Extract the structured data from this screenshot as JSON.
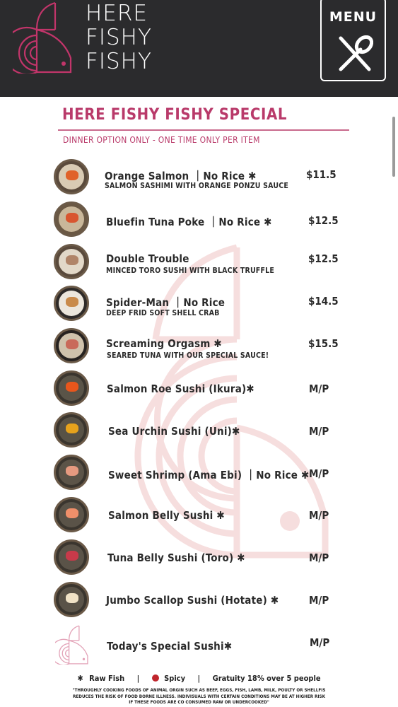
{
  "brand": {
    "line1": "HERE",
    "line2": "FISHY",
    "line3": "FISHY",
    "accent_color": "#c2356a",
    "header_bg": "#2b2b2d"
  },
  "menu_button": {
    "label": "MENU",
    "icon": "fork-spoon-icon"
  },
  "section": {
    "title": "HERE FISHY FISHY SPECIAL",
    "subtitle": "DINNER OPTION ONLY - ONE TIME ONLY PER ITEM"
  },
  "items": [
    {
      "name": "Orange Salmon ｜No Rice ✱",
      "desc": "SALMON SASHIMI WITH ORANGE PONZU SAUCE",
      "price": "$11.5"
    },
    {
      "name": "Bluefin Tuna Poke ｜No Rice ✱",
      "desc": "",
      "price": "$12.5"
    },
    {
      "name": "Double Trouble",
      "desc": "MINCED TORO SUSHI WITH BLACK TRUFFLE",
      "price": "$12.5"
    },
    {
      "name": "Spider-Man ｜No Rice",
      "desc": "DEEP FRID SOFT SHELL CRAB",
      "price": "$14.5"
    },
    {
      "name": "Screaming Orgasm ✱",
      "desc": "SEARED TUNA WITH OUR SPECIAL SAUCE!",
      "price": "$15.5"
    },
    {
      "name": "Salmon Roe Sushi (Ikura)✱",
      "desc": "",
      "price": "M/P"
    },
    {
      "name": "Sea Urchin Sushi (Uni)✱",
      "desc": "",
      "price": "M/P"
    },
    {
      "name": "Sweet Shrimp (Ama Ebi) ｜No Rice ✱",
      "desc": "",
      "price": "M/P"
    },
    {
      "name": "Salmon Belly Sushi ✱",
      "desc": "",
      "price": "M/P"
    },
    {
      "name": "Tuna Belly Sushi (Toro) ✱",
      "desc": "",
      "price": "M/P"
    },
    {
      "name": "Jumbo Scallop Sushi (Hotate) ✱",
      "desc": "",
      "price": "M/P"
    },
    {
      "name": "Today's Special Sushi✱",
      "desc": "",
      "price": "M/P"
    }
  ],
  "legend": {
    "raw_symbol": "✱",
    "raw_label": "Raw Fish",
    "spicy_label": "Spicy",
    "spicy_color": "#c0262d",
    "separator": "|",
    "gratuity": "Gratuity 18% over 5 people"
  },
  "disclaimer": "\"THROUGHLY COOKING FOODS OF ANIMAL ORGIN SUCH AS BEEF, EGGS, FISH, LAMB, MILK, POULTY OR SHELLFIS REDUCES THE RISK OF FOOD BORNE ILLNESS. INDIVISUALS WITH CERTAIN CONDITIONS MAY BE AT HIGHER RISK IF THESE FOODS ARE CO CONSUMED RAW OR UNDERCOOKED\""
}
